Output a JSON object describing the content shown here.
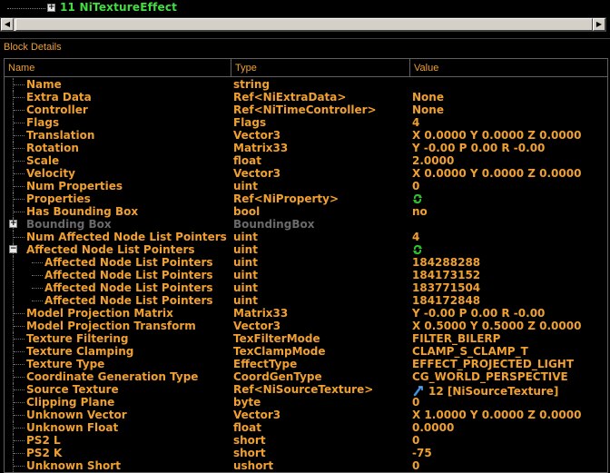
{
  "tree": {
    "expander": "+",
    "node_label": "11 NiTextureEffect"
  },
  "block_details": {
    "title": "Block Details",
    "columns": {
      "name": "Name",
      "type": "Type",
      "value": "Value"
    },
    "rows": [
      {
        "name": "Name",
        "type": "string",
        "value": ""
      },
      {
        "name": "Extra Data",
        "type": "Ref<NiExtraData>",
        "value": "None"
      },
      {
        "name": "Controller",
        "type": "Ref<NiTimeController>",
        "value": "None"
      },
      {
        "name": "Flags",
        "type": "Flags",
        "value": "4"
      },
      {
        "name": "Translation",
        "type": "Vector3",
        "value": "X 0.0000 Y 0.0000 Z 0.0000"
      },
      {
        "name": "Rotation",
        "type": "Matrix33",
        "value": "Y -0.00 P 0.00 R -0.00"
      },
      {
        "name": "Scale",
        "type": "float",
        "value": "2.0000"
      },
      {
        "name": "Velocity",
        "type": "Vector3",
        "value": "X 0.0000 Y 0.0000 Z 0.0000"
      },
      {
        "name": "Num Properties",
        "type": "uint",
        "value": "0"
      },
      {
        "name": "Properties",
        "type": "Ref<NiProperty>",
        "value": "",
        "icon": "link-icon"
      },
      {
        "name": "Has Bounding Box",
        "type": "bool",
        "value": "no"
      },
      {
        "name": "Bounding Box",
        "type": "BoundingBox",
        "value": "",
        "disabled": true,
        "expander": "+"
      },
      {
        "name": "Num Affected Node List Pointers",
        "type": "uint",
        "value": "4"
      },
      {
        "name": "Affected Node List Pointers",
        "type": "uint",
        "value": "",
        "icon": "link-icon",
        "expander": "−"
      },
      {
        "name": "Affected Node List Pointers",
        "type": "uint",
        "value": "184288288",
        "child": true
      },
      {
        "name": "Affected Node List Pointers",
        "type": "uint",
        "value": "184173152",
        "child": true
      },
      {
        "name": "Affected Node List Pointers",
        "type": "uint",
        "value": "183771504",
        "child": true
      },
      {
        "name": "Affected Node List Pointers",
        "type": "uint",
        "value": "184172848",
        "child": true
      },
      {
        "name": "Model Projection Matrix",
        "type": "Matrix33",
        "value": "Y -0.00 P 0.00 R -0.00"
      },
      {
        "name": "Model Projection Transform",
        "type": "Vector3",
        "value": "X 0.5000 Y 0.5000 Z 0.0000"
      },
      {
        "name": "Texture Filtering",
        "type": "TexFilterMode",
        "value": "FILTER_BILERP"
      },
      {
        "name": "Texture Clamping",
        "type": "TexClampMode",
        "value": "CLAMP_S_CLAMP_T"
      },
      {
        "name": "Texture Type",
        "type": "EffectType",
        "value": "EFFECT_PROJECTED_LIGHT"
      },
      {
        "name": "Coordinate Generation Type",
        "type": "CoordGenType",
        "value": "CG_WORLD_PERSPECTIVE"
      },
      {
        "name": "Source Texture",
        "type": "Ref<NiSourceTexture>",
        "value": "12 [NiSourceTexture]",
        "icon": "ref-icon"
      },
      {
        "name": "Clipping Plane",
        "type": "byte",
        "value": "0"
      },
      {
        "name": "Unknown Vector",
        "type": "Vector3",
        "value": "X 1.0000 Y 0.0000 Z 0.0000"
      },
      {
        "name": "Unknown Float",
        "type": "float",
        "value": "0.0000"
      },
      {
        "name": "PS2 L",
        "type": "short",
        "value": "0"
      },
      {
        "name": "PS2 K",
        "type": "short",
        "value": "-75"
      },
      {
        "name": "Unknown Short",
        "type": "ushort",
        "value": "0"
      }
    ]
  },
  "colors": {
    "text": "#f0a030",
    "node_label": "#40e040",
    "disabled": "#6a6a6a",
    "background": "#000000"
  }
}
